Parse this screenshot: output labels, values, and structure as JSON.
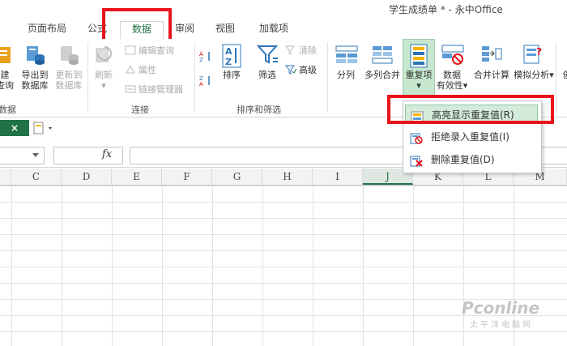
{
  "window": {
    "title": "学生成绩单 * - 永中Office"
  },
  "tabs": [
    {
      "label": "页面布局"
    },
    {
      "label": "公式"
    },
    {
      "label": "数据",
      "active": true
    },
    {
      "label": "审阅"
    },
    {
      "label": "视图"
    },
    {
      "label": "加载项"
    }
  ],
  "ribbon": {
    "get_data": {
      "line1": "建",
      "line2": "查询",
      "group_label": "数据"
    },
    "export": {
      "line1": "导出到",
      "line2": "数据库"
    },
    "update": {
      "line1": "更新到",
      "line2": "数据库"
    },
    "refresh": {
      "label": "刷新"
    },
    "edit_query": {
      "label": "编辑查询"
    },
    "properties": {
      "label": "属性"
    },
    "link_manager": {
      "label": "链接管理器"
    },
    "connection_group": "连接",
    "sort_asc": "A↓Z",
    "sort": {
      "label": "排序"
    },
    "filter": {
      "label": "筛选"
    },
    "clear": {
      "label": "清除"
    },
    "advanced": {
      "label": "高级"
    },
    "sort_filter_group": "排序和筛选",
    "split": {
      "label": "分列"
    },
    "merge_cols": {
      "label": "多列合并"
    },
    "duplicates": {
      "label": "重复项"
    },
    "validation": {
      "line1": "数据",
      "line2": "有效性"
    },
    "consolidate": {
      "label": "合并计算"
    },
    "whatif": {
      "label": "模拟分析"
    },
    "cut_label": "创"
  },
  "quick_access": {
    "close_tab": "×"
  },
  "formula_bar": {
    "fx": "fx"
  },
  "columns": [
    "C",
    "D",
    "E",
    "F",
    "G",
    "H",
    "I",
    "J",
    "K",
    "L",
    "M"
  ],
  "selected_column": "J",
  "dropdown": {
    "items": [
      {
        "label": "高亮显示重复值(R)",
        "icon": "highlight-duplicates-icon",
        "highlighted": true
      },
      {
        "label": "拒绝录入重复值(I)",
        "icon": "reject-duplicates-icon"
      },
      {
        "label": "删除重复值(D)",
        "icon": "delete-duplicates-icon"
      }
    ]
  },
  "watermark": {
    "main": "Pconline",
    "sub": "太平洋电脑网"
  },
  "colors": {
    "accent": "#217346",
    "annotation_red": "#e8141c",
    "highlight": "#d3ebdb"
  }
}
